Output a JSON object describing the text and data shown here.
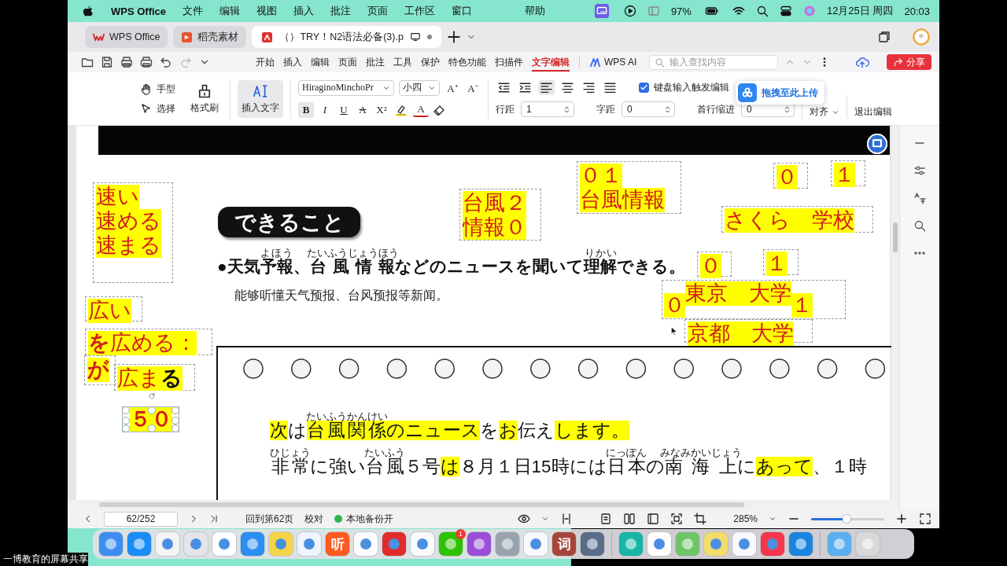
{
  "menubar": {
    "app": "WPS Office",
    "menus": [
      "文件",
      "编辑",
      "视图",
      "插入",
      "批注",
      "页面",
      "工作区",
      "窗口"
    ],
    "help": "帮助",
    "battery": "97%",
    "date": "12月25日 周四",
    "time": "20:03"
  },
  "tabs": [
    {
      "label": "WPS Office",
      "selected": false
    },
    {
      "label": "稻壳素材",
      "selected": false
    },
    {
      "label": "（）TRY！N2语法必备(3).p",
      "selected": true
    }
  ],
  "ribbon_tabs": [
    {
      "label": "开始",
      "selected": false
    },
    {
      "label": "插入",
      "selected": false
    },
    {
      "label": "编辑",
      "selected": false
    },
    {
      "label": "页面",
      "selected": false
    },
    {
      "label": "批注",
      "selected": false
    },
    {
      "label": "工具",
      "selected": false
    },
    {
      "label": "保护",
      "selected": false
    },
    {
      "label": "特色功能",
      "selected": false
    },
    {
      "label": "扫描件",
      "selected": false
    },
    {
      "label": "文字编辑",
      "selected": true
    }
  ],
  "wps_ai": "WPS AI",
  "search": {
    "placeholder": "输入查找内容"
  },
  "share": "分享",
  "toolbar": {
    "hand": "手型",
    "select": "选择",
    "format_painter": "格式刷",
    "insert_text": {
      "label": "插入文字",
      "selected": true
    },
    "font": "HiraginoMinchoPr",
    "size": "小四",
    "grow": "A⁺",
    "shrink": "A⁻",
    "format_buttons": [
      {
        "label": "B",
        "kind": "bold",
        "selected": true
      },
      {
        "label": "I",
        "kind": "italic",
        "selected": false
      },
      {
        "label": "U",
        "kind": "underline",
        "selected": false
      },
      {
        "label": "A",
        "kind": "strike",
        "selected": false
      },
      {
        "label": "X²",
        "kind": "super",
        "selected": false
      }
    ],
    "font_color": "A",
    "paragraph_buttons": [
      {
        "kind": "outdent",
        "selected": false
      },
      {
        "kind": "indent",
        "selected": false
      },
      {
        "kind": "left",
        "selected": true
      },
      {
        "kind": "center",
        "selected": false
      },
      {
        "kind": "right",
        "selected": false
      },
      {
        "kind": "justify",
        "selected": false
      }
    ],
    "keyboard_edit": {
      "label": "键盘输入触发编辑",
      "checked": true
    },
    "line_spacing": {
      "label": "行距",
      "value": "1"
    },
    "char_spacing": {
      "label": "字距",
      "value": "0"
    },
    "indent": {
      "label": "首行缩进",
      "value": "0"
    },
    "align": "对齐",
    "exit": "退出编辑",
    "upload_popup": "拖拽至此上传"
  },
  "document": {
    "heading": "できること",
    "goal_sentence": [
      {
        "text": "●天気"
      },
      {
        "text": "予報",
        "ruby": "よほう"
      },
      {
        "text": "、"
      },
      {
        "text": "台風情報",
        "ruby": "たいふうじょうほう"
      },
      {
        "text": "などのニュースを聞いて"
      },
      {
        "text": "理解",
        "ruby": "りかい"
      },
      {
        "text": "できる。"
      }
    ],
    "goal_translation": "能够听懂天气预报、台风预报等新闻。",
    "practice_lines": [
      [
        {
          "text": "次",
          "highlight": true
        },
        {
          "text": "は",
          "highlight": false
        },
        {
          "text": "台風関係",
          "ruby": "たいふうかんけい",
          "highlight": true
        },
        {
          "text": "のニュース",
          "highlight": true
        },
        {
          "text": "を",
          "highlight": false
        },
        {
          "text": "お",
          "highlight": true
        },
        {
          "text": "伝え",
          "highlight": false
        },
        {
          "text": "します。",
          "highlight": true
        }
      ],
      [
        {
          "text": "非常",
          "ruby": "ひじょう",
          "highlight": false
        },
        {
          "text": "に強い",
          "highlight": false
        },
        {
          "text": "台風",
          "ruby": "たいふう",
          "highlight": false
        },
        {
          "text": "５号",
          "highlight": false
        },
        {
          "text": "は",
          "highlight": true
        },
        {
          "text": "８月１日15時には",
          "highlight": false
        },
        {
          "text": "日本",
          "ruby": "にっぽん",
          "highlight": false
        },
        {
          "text": "の",
          "highlight": false
        },
        {
          "text": "南海上",
          "ruby": "みなみかいじょう",
          "highlight": false
        },
        {
          "text": "に",
          "highlight": false
        },
        {
          "text": "あって",
          "highlight": true
        },
        {
          "text": "、１時",
          "highlight": false
        }
      ]
    ],
    "annotations": [
      {
        "kind": "stack",
        "lines": [
          "速い",
          "速める",
          "速まる"
        ],
        "selected": false
      },
      {
        "kind": "stack",
        "lines": [
          "広い"
        ],
        "selected": false
      },
      {
        "kind": "stack",
        "lines": [
          "**を**広める："
        ],
        "selected": false
      },
      {
        "kind": "stack",
        "lines": [
          "**が**"
        ],
        "selected": false
      },
      {
        "kind": "stack",
        "lines": [
          "広ま**る**"
        ],
        "selected": false
      },
      {
        "kind": "stack",
        "lines": [
          "５０"
        ],
        "selected": true
      },
      {
        "kind": "stack",
        "lines": [
          "台風２",
          "情報０"
        ],
        "selected": false
      },
      {
        "kind": "stack",
        "lines": [
          "０１",
          "台風情報"
        ],
        "selected": false
      },
      {
        "kind": "stack",
        "lines": [
          "０"
        ],
        "selected": false
      },
      {
        "kind": "stack",
        "lines": [
          "１"
        ],
        "selected": false
      },
      {
        "kind": "stack",
        "lines": [
          "さくら　学校"
        ],
        "selected": false
      },
      {
        "kind": "stack",
        "lines": [
          "０"
        ],
        "selected": false
      },
      {
        "kind": "stack",
        "lines": [
          "１"
        ],
        "selected": false
      },
      {
        "kind": "row",
        "lines": [
          "０",
          "東京　大学",
          "１"
        ],
        "selected": false
      },
      {
        "kind": "stack",
        "lines": [
          "京都　大学"
        ],
        "selected": false
      }
    ]
  },
  "status_bar": {
    "page": "62/252",
    "goto": "回到第62页",
    "proofread": "校对",
    "backup": "本地备份开",
    "zoom": "285%",
    "zoom_slider": {
      "level": 0.48
    }
  },
  "dock": [
    {
      "kind": "app",
      "color": "#3d8ef0"
    },
    {
      "kind": "app",
      "color": "#1a8cf5"
    },
    {
      "kind": "app",
      "color": "#f4f4f4"
    },
    {
      "kind": "app",
      "color": "#e4e4ec"
    },
    {
      "kind": "app",
      "color": "#ffffff"
    },
    {
      "kind": "app",
      "color": "#2a8ff0"
    },
    {
      "kind": "app",
      "color": "#f7d54a"
    },
    {
      "kind": "app",
      "color": "#f0f4ff"
    },
    {
      "kind": "app",
      "color": "#ff5a1f",
      "glyph": "听"
    },
    {
      "kind": "app",
      "color": "#fdfdfd"
    },
    {
      "kind": "app",
      "color": "#e02b2b"
    },
    {
      "kind": "app",
      "color": "#fafafa"
    },
    {
      "kind": "app",
      "color": "#2dc100",
      "badge": "1"
    },
    {
      "kind": "app",
      "color": "#9b4fd8"
    },
    {
      "kind": "app",
      "color": "#9aa3ad"
    },
    {
      "kind": "app",
      "color": "#f8f8ff"
    },
    {
      "kind": "app",
      "color": "#a8453b",
      "glyph": "词"
    },
    {
      "kind": "app",
      "color": "#5a6d88"
    },
    {
      "kind": "separator"
    },
    {
      "kind": "app",
      "color": "#16b5a7"
    },
    {
      "kind": "app",
      "color": "#ffffff"
    },
    {
      "kind": "app",
      "color": "#6fc46a"
    },
    {
      "kind": "app",
      "color": "#f2dc6a"
    },
    {
      "kind": "app",
      "color": "#f8f8ff"
    },
    {
      "kind": "app",
      "color": "#f5364d"
    },
    {
      "kind": "app",
      "color": "#1a84e0"
    },
    {
      "kind": "separator"
    },
    {
      "kind": "app",
      "color": "#5ab0ee"
    },
    {
      "kind": "app",
      "color": "#d9d9d9"
    }
  ],
  "caption": "一博教育的屏幕共享"
}
